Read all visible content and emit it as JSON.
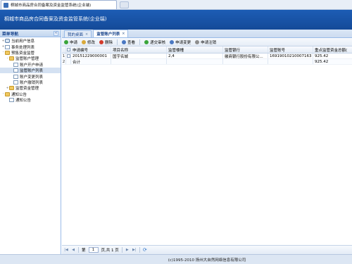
{
  "browser": {
    "tab_title": "桐城市商品房合同备案及资金监管系统(企业端)"
  },
  "app": {
    "title": "桐城市商品房合同备案及资金监管系统(企业端)"
  },
  "sidebar": {
    "header": "菜单导航",
    "items": [
      {
        "label": "当前用户信息",
        "level": 0,
        "icon": "user-icon",
        "toggle": "+"
      },
      {
        "label": "事务处理列表",
        "level": 0,
        "icon": "document-icon",
        "toggle": "+"
      },
      {
        "label": "预售资金监管",
        "level": 0,
        "icon": "folder-icon",
        "toggle": "-"
      },
      {
        "label": "监管账户管理",
        "level": 1,
        "icon": "folder-icon",
        "toggle": "-"
      },
      {
        "label": "账户开户申请",
        "level": 2,
        "icon": "document-icon",
        "toggle": ""
      },
      {
        "label": "监管账户列表",
        "level": 2,
        "icon": "document-icon",
        "toggle": "",
        "selected": true
      },
      {
        "label": "账户变更列表",
        "level": 2,
        "icon": "document-icon",
        "toggle": ""
      },
      {
        "label": "账户撤销列表",
        "level": 2,
        "icon": "document-icon",
        "toggle": ""
      },
      {
        "label": "监管资金管理",
        "level": 1,
        "icon": "folder-icon",
        "toggle": "+"
      },
      {
        "label": "通知公告",
        "level": 0,
        "icon": "folder-icon",
        "toggle": "-"
      },
      {
        "label": "通知公告",
        "level": 1,
        "icon": "document-icon",
        "toggle": ""
      }
    ]
  },
  "tabs": [
    {
      "label": "我的桌面",
      "active": false
    },
    {
      "label": "监管账户列表",
      "active": true
    }
  ],
  "toolbar": {
    "buttons": [
      {
        "label": "申请",
        "icon": "add-icon",
        "color": "#3aa53a"
      },
      {
        "label": "修改",
        "icon": "edit-icon",
        "color": "#d9a93a"
      },
      {
        "label": "删除",
        "icon": "delete-icon",
        "color": "#d33b2c"
      },
      {
        "label": "查看",
        "icon": "view-icon",
        "color": "#4a78c2"
      },
      {
        "label": "递交审核",
        "icon": "submit-icon",
        "color": "#3aa53a"
      },
      {
        "label": "申请变更",
        "icon": "change-icon",
        "color": "#4a78c2"
      },
      {
        "label": "申请注销",
        "icon": "cancel-icon",
        "color": "#8e8e8e"
      }
    ]
  },
  "grid": {
    "columns": [
      "申请编号",
      "项目名称",
      "监管楼幢",
      "监管银行",
      "监管账号",
      "重点监管资金总额("
    ],
    "rows": [
      {
        "num": "1",
        "cells": [
          "20151229000001",
          "国宇名城",
          "2,4",
          "徽商银行股份有限公...",
          "16919010210007163 17",
          "925.42"
        ]
      },
      {
        "num": "2",
        "cells": [
          "合计",
          "",
          "",
          "",
          "",
          "925.42"
        ]
      }
    ]
  },
  "pager": {
    "first": "|◀",
    "prev": "◀",
    "page_label": "第",
    "page_value": "1",
    "total": "页,共 1 页",
    "next": "▶",
    "last": "▶|",
    "refresh": "⟳"
  },
  "footer": {
    "text": "(c)1995-2010 扬州大自然网络信息有限公司"
  }
}
